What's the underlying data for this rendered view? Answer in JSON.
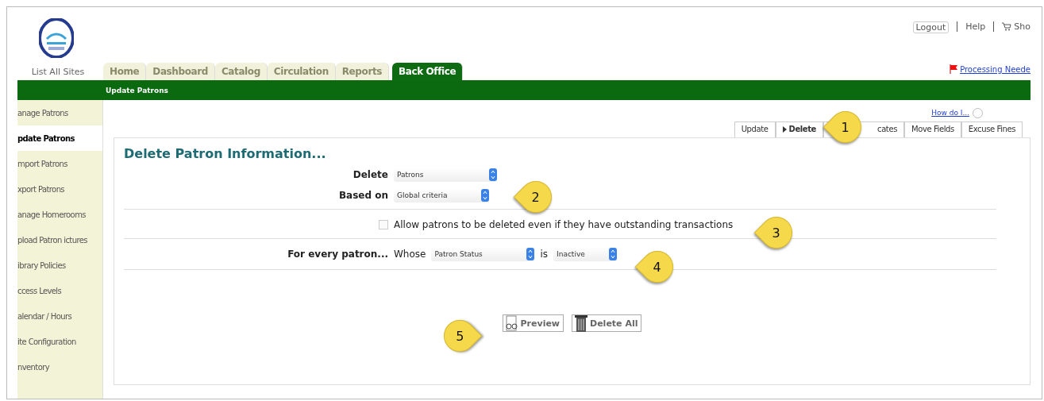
{
  "header": {
    "site_link": "List All Sites",
    "top_links": [
      {
        "label": "Logout",
        "kind": "boxed"
      },
      {
        "label": "Help",
        "kind": "plain"
      },
      {
        "label": "Sho",
        "kind": "cart"
      }
    ],
    "alert_link": "Processing Neede"
  },
  "nav_tabs": [
    {
      "label": "Home",
      "selected": false
    },
    {
      "label": "Dashboard",
      "selected": false
    },
    {
      "label": "Catalog",
      "selected": false
    },
    {
      "label": "Circulation",
      "selected": false
    },
    {
      "label": "Reports",
      "selected": false
    },
    {
      "label": "Back Office",
      "selected": true
    }
  ],
  "subtitle": "Update Patrons",
  "sidebar": {
    "items": [
      {
        "label": "anage Patrons",
        "selected": false
      },
      {
        "label": "pdate Patrons",
        "selected": true
      },
      {
        "label": "mport Patrons",
        "selected": false
      },
      {
        "label": "xport Patrons",
        "selected": false
      },
      {
        "label": "anage Homerooms",
        "selected": false
      },
      {
        "label": "pload Patron ictures",
        "selected": false
      },
      {
        "label": "ibrary Policies",
        "selected": false
      },
      {
        "label": "ccess Levels",
        "selected": false
      },
      {
        "label": "alendar / Hours",
        "selected": false
      },
      {
        "label": "ite Configuration",
        "selected": false
      },
      {
        "label": "nventory",
        "selected": false
      }
    ]
  },
  "help_link": "How do I...",
  "sub_tabs": [
    {
      "label": "Update",
      "selected": false
    },
    {
      "label": "Delete",
      "selected": true
    },
    {
      "label": "cates",
      "selected": false,
      "kind": "covered"
    },
    {
      "label": "Move Fields",
      "selected": false
    },
    {
      "label": "Excuse Fines",
      "selected": false
    }
  ],
  "panel": {
    "title": "Delete Patron Information...",
    "fields": [
      {
        "label": "Delete",
        "value": "Patrons"
      },
      {
        "label": "Based on",
        "value": "Global criteria"
      }
    ],
    "allow_outstanding": {
      "label": "Allow patrons to be deleted even if they have outstanding transactions",
      "checked": false
    },
    "criteria": {
      "label": "For every patron...",
      "whose": "Whose",
      "field": "Patron Status",
      "operator": "is",
      "value": "Inactive"
    },
    "buttons": [
      {
        "label": "Preview",
        "kind": "preview"
      },
      {
        "label": "Delete All",
        "kind": "delete"
      }
    ]
  },
  "callouts": [
    {
      "number": "1",
      "kind": "left"
    },
    {
      "number": "2",
      "kind": "left"
    },
    {
      "number": "3",
      "kind": "left"
    },
    {
      "number": "4",
      "kind": "left"
    },
    {
      "number": "5",
      "kind": "right"
    }
  ]
}
